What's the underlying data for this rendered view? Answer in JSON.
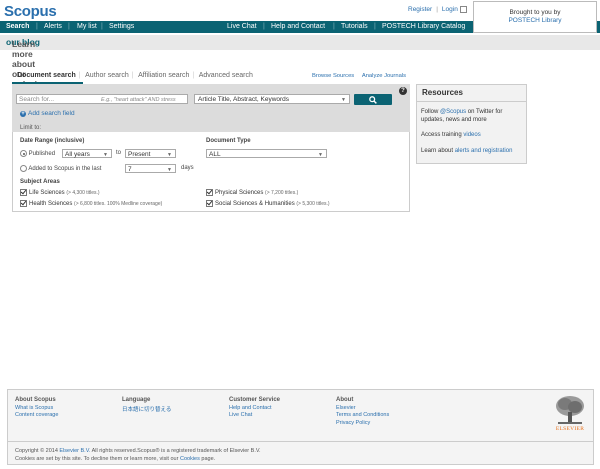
{
  "header": {
    "logo": "Scopus",
    "register": "Register",
    "login": "Login",
    "brought_to_you_by": "Brought to you by",
    "institution": "POSTECH Library"
  },
  "nav": {
    "left": [
      "Search",
      "Alerts",
      "My list",
      "Settings"
    ],
    "right": [
      "Live Chat",
      "Help and Contact",
      "Tutorials",
      "POSTECH Library Catalog"
    ]
  },
  "banner": {
    "text": "Learn more about our redesign on ",
    "link": "our blog"
  },
  "tabs": [
    "Document search",
    "Author search",
    "Affiliation search",
    "Advanced search"
  ],
  "tab_links": {
    "browse": "Browse Sources",
    "analyze": "Analyze Journals"
  },
  "search": {
    "placeholder": "Search for...",
    "example": "E.g., \"heart attack\" AND stress",
    "field": "Article Title, Abstract, Keywords",
    "help": "?",
    "add_field": "Add search field",
    "limit_to": "Limit to:"
  },
  "date_range": {
    "label": "Date Range (inclusive)",
    "published": "Published",
    "from": "All years",
    "to_label": "to",
    "to": "Present",
    "added": "Added to Scopus in the last",
    "days_value": "7",
    "days": "days"
  },
  "doc_type": {
    "label": "Document Type",
    "value": "ALL"
  },
  "subject_areas": {
    "label": "Subject Areas",
    "items": [
      {
        "name": "Life Sciences",
        "count": "(> 4,300 titles.)"
      },
      {
        "name": "Physical Sciences",
        "count": "(> 7,200 titles.)"
      },
      {
        "name": "Health Sciences",
        "count": "(> 6,800 titles. 100% Medline coverage)"
      },
      {
        "name": "Social Sciences & Humanities",
        "count": "(> 5,300 titles.)"
      }
    ]
  },
  "resources": {
    "title": "Resources",
    "twitter_pre": "Follow ",
    "twitter_link": "@Scopus",
    "twitter_post": " on Twitter for updates, news and more",
    "training_pre": "Access training ",
    "training_link": "videos",
    "learn_pre": "Learn about ",
    "learn_link": "alerts and registration"
  },
  "footer": {
    "about_scopus": {
      "title": "About Scopus",
      "links": [
        "What is Scopus",
        "Content coverage"
      ]
    },
    "language": {
      "title": "Language",
      "links": [
        "日本語に切り替える"
      ]
    },
    "customer": {
      "title": "Customer Service",
      "links": [
        "Help and Contact",
        "Live Chat"
      ]
    },
    "about": {
      "title": "About",
      "links": [
        "Elsevier",
        "Terms and Conditions",
        "Privacy Policy"
      ]
    },
    "publisher": "ELSEVIER",
    "copyright_pre": "Copyright © 2014 ",
    "copyright_link": "Elsevier B.V.",
    "copyright_post": " All rights reserved.Scopus® is a registered trademark of Elsevier B.V.",
    "cookies_pre": "Cookies are set by this site. To decline them or learn more, visit our ",
    "cookies_link": "Cookies",
    "cookies_post": " page."
  },
  "colors": {
    "nav_bg": "#0b6373",
    "link": "#2a6fad",
    "publisher_orange": "#e9711c"
  }
}
